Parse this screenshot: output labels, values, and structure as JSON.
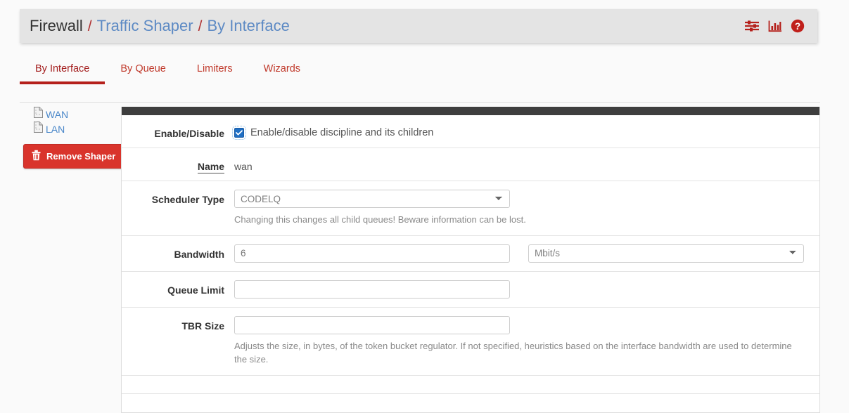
{
  "breadcrumb": {
    "root": "Firewall",
    "sep": "/",
    "middle": "Traffic Shaper",
    "current": "By Interface",
    "icons": [
      {
        "name": "sliders-icon",
        "title": "Sliders"
      },
      {
        "name": "chart-icon",
        "title": "Status"
      },
      {
        "name": "help-icon",
        "title": "Help"
      }
    ],
    "accent_color": "#b03030",
    "link_color": "#5d8ac4",
    "background": "#e4e4e4"
  },
  "tabs": [
    {
      "label": "By Interface",
      "active": true
    },
    {
      "label": "By Queue",
      "active": false
    },
    {
      "label": "Limiters",
      "active": false
    },
    {
      "label": "Wizards",
      "active": false
    }
  ],
  "sidebar": {
    "tree": [
      {
        "label": "WAN",
        "icon": "page-icon"
      },
      {
        "label": "LAN",
        "icon": "page-icon"
      }
    ],
    "remove_button": {
      "label": "Remove Shaper",
      "icon": "trash-icon",
      "color": "#d9342c"
    }
  },
  "form": {
    "rows": [
      {
        "id": "enable-disable",
        "label": "Enable/Disable",
        "type": "checkbox",
        "checked": true,
        "checkbox_label": "Enable/disable discipline and its children"
      },
      {
        "id": "name",
        "label": "Name",
        "label_underlined": true,
        "type": "static",
        "value": "wan"
      },
      {
        "id": "scheduler-type",
        "label": "Scheduler Type",
        "type": "select",
        "value": "CODELQ",
        "options": [
          "CODELQ"
        ],
        "help": "Changing this changes all child queues! Beware information can be lost."
      },
      {
        "id": "bandwidth",
        "label": "Bandwidth",
        "type": "input-with-unit",
        "value": "6",
        "unit_value": "Mbit/s",
        "unit_options": [
          "Mbit/s"
        ]
      },
      {
        "id": "queue-limit",
        "label": "Queue Limit",
        "type": "input",
        "value": ""
      },
      {
        "id": "tbr-size",
        "label": "TBR Size",
        "type": "input",
        "value": "",
        "help": "Adjusts the size, in bytes, of the token bucket regulator. If not specified, heuristics based on the interface bandwidth are used to determine the size."
      }
    ]
  }
}
